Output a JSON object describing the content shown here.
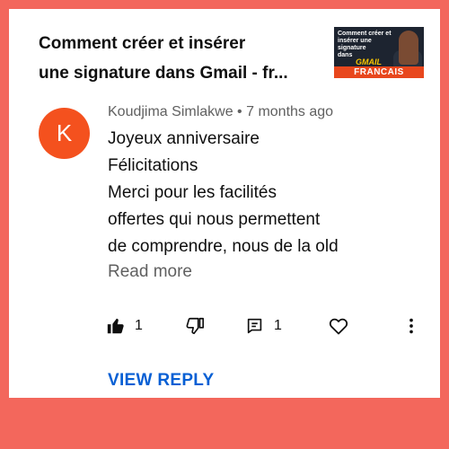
{
  "video": {
    "title_line1": "Comment créer et insérer",
    "title_line2": "une signature dans Gmail - fr...",
    "thumbnail": {
      "text_line1": "Comment créer et",
      "text_line2": "insérer une signature",
      "text_line3": "dans",
      "gmail": "GMAIL",
      "banner": "FRANCAIS"
    }
  },
  "comment": {
    "avatar_letter": "K",
    "avatar_color": "#f4511e",
    "meta": "Koudjima Simlakwe • 7 months ago",
    "lines": [
      "Joyeux anniversaire",
      "Félicitations",
      "Merci pour les facilités",
      "offertes qui nous permettent",
      "de comprendre, nous de la old"
    ],
    "read_more": "Read more"
  },
  "actions": {
    "like_count": "1",
    "reply_count": "1"
  },
  "view_reply": "VIEW REPLY",
  "colors": {
    "background": "#f3675c",
    "link": "#065fd4"
  }
}
